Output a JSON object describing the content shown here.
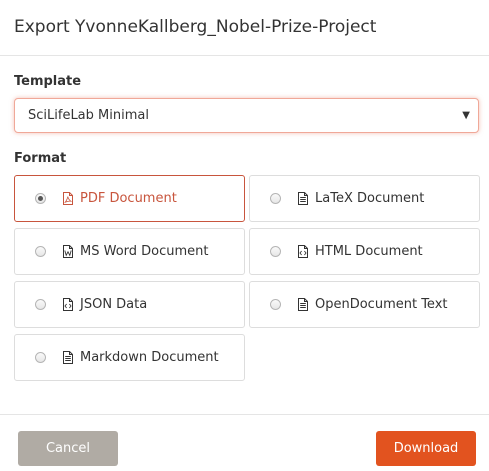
{
  "dialog": {
    "title": "Export YvonneKallberg_Nobel-Prize-Project"
  },
  "template": {
    "label": "Template",
    "selected_value": "SciLifeLab Minimal"
  },
  "format": {
    "label": "Format",
    "options": [
      {
        "label": "PDF Document",
        "icon": "pdf-file-icon",
        "selected": true
      },
      {
        "label": "LaTeX Document",
        "icon": "document-file-icon",
        "selected": false
      },
      {
        "label": "MS Word Document",
        "icon": "word-file-icon",
        "selected": false
      },
      {
        "label": "HTML Document",
        "icon": "code-file-icon",
        "selected": false
      },
      {
        "label": "JSON Data",
        "icon": "code-file-icon",
        "selected": false
      },
      {
        "label": "OpenDocument Text",
        "icon": "document-file-icon",
        "selected": false
      },
      {
        "label": "Markdown Document",
        "icon": "document-file-icon",
        "selected": false
      }
    ]
  },
  "footer": {
    "cancel_label": "Cancel",
    "download_label": "Download"
  },
  "colors": {
    "accent": "#c8553d",
    "download_button": "#e2531f",
    "cancel_button": "#b0aba4",
    "select_focus_border": "#f0a898"
  }
}
